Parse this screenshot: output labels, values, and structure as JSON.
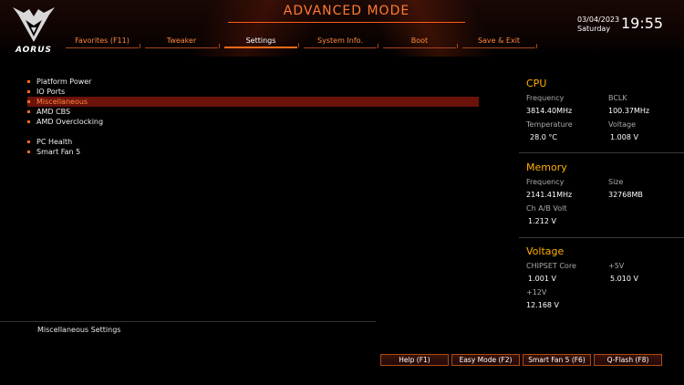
{
  "brand": {
    "logo_text": "AORUS"
  },
  "header": {
    "mode_title": "ADVANCED MODE",
    "date": "03/04/2023",
    "day": "Saturday",
    "time": "19:55"
  },
  "tabs": [
    {
      "label": "Favorites (F11)"
    },
    {
      "label": "Tweaker"
    },
    {
      "label": "Settings"
    },
    {
      "label": "System Info."
    },
    {
      "label": "Boot"
    },
    {
      "label": "Save & Exit"
    }
  ],
  "active_tab": "Settings",
  "menu": {
    "group1": [
      {
        "label": "Platform Power"
      },
      {
        "label": "IO Ports"
      },
      {
        "label": "Miscellaneous"
      },
      {
        "label": "AMD CBS"
      },
      {
        "label": "AMD Overclocking"
      }
    ],
    "group2": [
      {
        "label": "PC Health"
      },
      {
        "label": "Smart Fan 5"
      }
    ],
    "selected": "Miscellaneous"
  },
  "cpu": {
    "title": "CPU",
    "frequency_label": "Frequency",
    "frequency_value": "3814.40MHz",
    "bclk_label": "BCLK",
    "bclk_value": "100.37MHz",
    "temperature_label": "Temperature",
    "temperature_value": "28.0 °C",
    "voltage_label": "Voltage",
    "voltage_value": "1.008 V"
  },
  "memory": {
    "title": "Memory",
    "frequency_label": "Frequency",
    "frequency_value": "2141.41MHz",
    "size_label": "Size",
    "size_value": "32768MB",
    "volt_label": "Ch A/B Volt",
    "volt_value": "1.212 V"
  },
  "voltage": {
    "title": "Voltage",
    "chipset_label": "CHIPSET Core",
    "chipset_value": "1.001 V",
    "p5v_label": "+5V",
    "p5v_value": "5.010 V",
    "p12v_label": "+12V",
    "p12v_value": "12.168 V"
  },
  "description": "Miscellaneous Settings",
  "buttons": {
    "help": "Help (F1)",
    "easy_mode": "Easy Mode (F2)",
    "smart_fan": "Smart Fan 5 (F6)",
    "qflash": "Q-Flash (F8)"
  },
  "colors": {
    "accent": "#ff6a1a",
    "section_title": "#ffb000",
    "selected_bg": "#6b120b"
  }
}
